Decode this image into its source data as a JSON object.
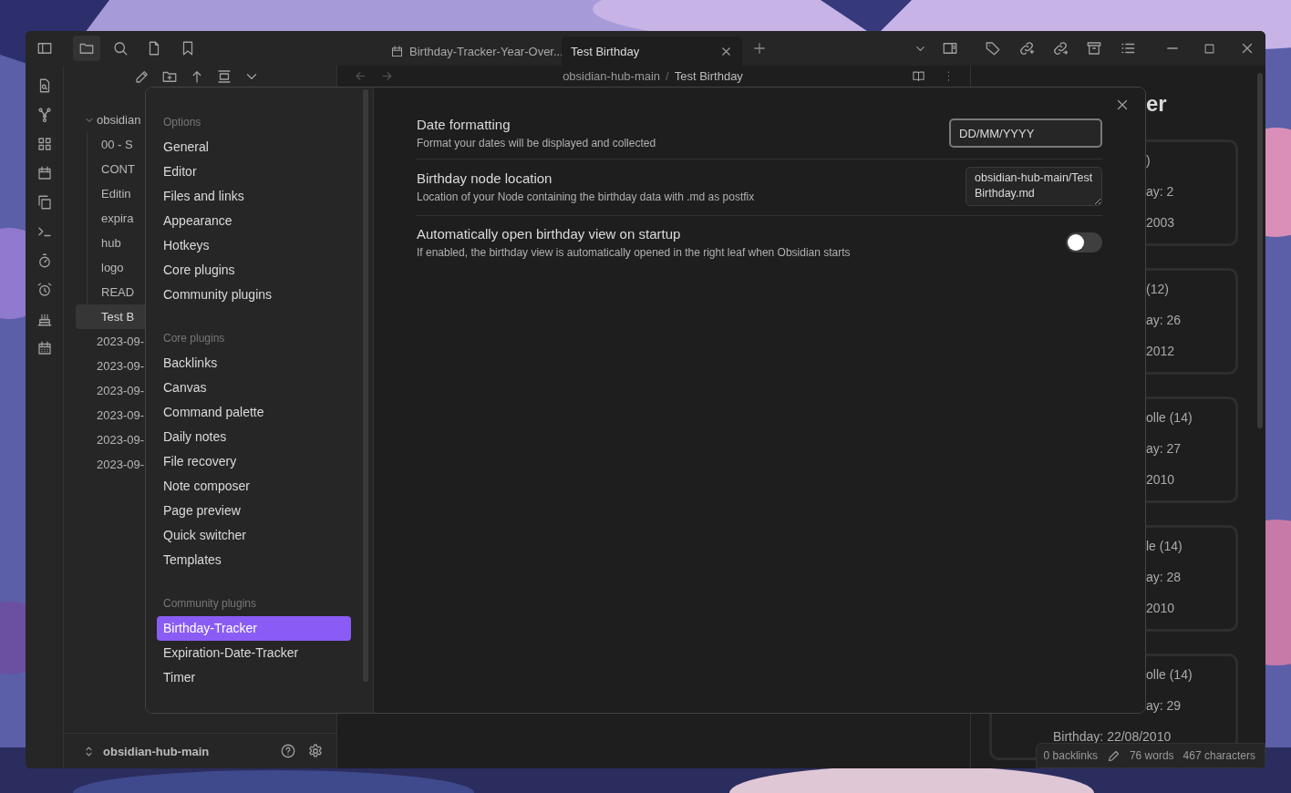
{
  "title_bar": {
    "tabs": [
      {
        "label": "Birthday-Tracker-Year-Over...",
        "selected": false,
        "kind": "view"
      },
      {
        "label": "Test Birthday",
        "selected": true,
        "kind": "note"
      }
    ]
  },
  "file_explorer": {
    "tree": [
      {
        "label": "obsidian",
        "expanded": true,
        "selected": false,
        "children": [
          {
            "label": "00 - S",
            "selected": false
          },
          {
            "label": "CONT",
            "selected": false
          },
          {
            "label": "Editin",
            "selected": false
          },
          {
            "label": "expira",
            "selected": false
          },
          {
            "label": "hub",
            "selected": false
          },
          {
            "label": "logo",
            "selected": false
          },
          {
            "label": "READ",
            "selected": false
          },
          {
            "label": "Test B",
            "selected": true
          }
        ]
      },
      {
        "label": "2023-09-",
        "selected": false
      },
      {
        "label": "2023-09-",
        "selected": false
      },
      {
        "label": "2023-09-",
        "selected": false
      },
      {
        "label": "2023-09-",
        "selected": false
      },
      {
        "label": "2023-09-",
        "selected": false
      },
      {
        "label": "2023-09-",
        "selected": false
      }
    ],
    "vault": "obsidian-hub-main"
  },
  "editor": {
    "breadcrumb": [
      "obsidian-hub-main",
      "Test Birthday"
    ],
    "separator": "/"
  },
  "right_panel": {
    "title": "er",
    "cards": [
      {
        "lines": [
          ")",
          "ay: 2",
          "2003"
        ]
      },
      {
        "lines": [
          "(12)",
          "ay: 26",
          "2012"
        ]
      },
      {
        "lines": [
          "olle (14)",
          "ay: 27",
          "2010"
        ]
      },
      {
        "lines": [
          "le (14)",
          "ay: 28",
          "2010"
        ]
      },
      {
        "lines": [
          "olle (14)",
          "ay: 29"
        ],
        "footer": "Birthday: 22/08/2010"
      }
    ]
  },
  "status_bar": {
    "backlinks": "0 backlinks",
    "words": "76 words",
    "characters": "467 characters"
  },
  "settings": {
    "nav": [
      {
        "heading": "Options",
        "items": [
          {
            "label": "General",
            "selected": false
          },
          {
            "label": "Editor",
            "selected": false
          },
          {
            "label": "Files and links",
            "selected": false
          },
          {
            "label": "Appearance",
            "selected": false
          },
          {
            "label": "Hotkeys",
            "selected": false
          },
          {
            "label": "Core plugins",
            "selected": false
          },
          {
            "label": "Community plugins",
            "selected": false
          }
        ]
      },
      {
        "heading": "Core plugins",
        "items": [
          {
            "label": "Backlinks",
            "selected": false
          },
          {
            "label": "Canvas",
            "selected": false
          },
          {
            "label": "Command palette",
            "selected": false
          },
          {
            "label": "Daily notes",
            "selected": false
          },
          {
            "label": "File recovery",
            "selected": false
          },
          {
            "label": "Note composer",
            "selected": false
          },
          {
            "label": "Page preview",
            "selected": false
          },
          {
            "label": "Quick switcher",
            "selected": false
          },
          {
            "label": "Templates",
            "selected": false
          }
        ]
      },
      {
        "heading": "Community plugins",
        "items": [
          {
            "label": "Birthday-Tracker",
            "selected": true
          },
          {
            "label": "Expiration-Date-Tracker",
            "selected": false
          },
          {
            "label": "Timer",
            "selected": false
          }
        ]
      }
    ],
    "rows": [
      {
        "kind": "text",
        "name": "Date formatting",
        "description": "Format your dates will be displayed and collected",
        "value": "DD/MM/YYYY",
        "focused": true
      },
      {
        "kind": "textarea",
        "name": "Birthday node location",
        "description": "Location of your Node containing the birthday data with .md as postfix",
        "value": "obsidian-hub-main/Test Birthday.md",
        "focused": false
      },
      {
        "kind": "toggle",
        "name": "Automatically open birthday view on startup",
        "description": "If enabled, the birthday view is automatically opened in the right leaf when Obsidian starts",
        "on": false
      }
    ]
  }
}
